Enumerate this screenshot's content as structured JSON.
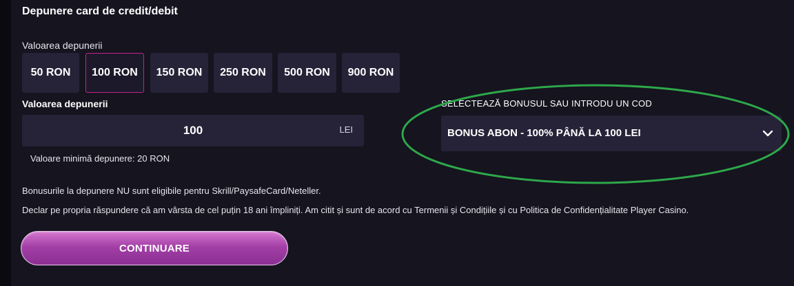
{
  "section": {
    "title": "Depunere card de credit/debit"
  },
  "amounts": {
    "label": "Valoarea depunerii",
    "options": [
      "50 RON",
      "100 RON",
      "150 RON",
      "250 RON",
      "500 RON",
      "900 RON"
    ],
    "selected": "100 RON"
  },
  "deposit": {
    "label": "Valoarea depunerii",
    "value": "100",
    "unit": "LEI",
    "min_note": "Valoare minimă depunere: 20 RON"
  },
  "bonus": {
    "label": "SELECTEAZĂ BONUSUL SAU INTRODU UN COD",
    "selected": "BONUS ABON - 100% PÂNĂ LA 100 LEI",
    "icon": "chevron-down-icon",
    "highlight_color": "#2ea84a"
  },
  "notices": {
    "eligibility": "Bonusurile la depunere NU sunt eligibile pentru Skrill/PaysafeCard/Neteller.",
    "declaration": "Declar pe propria răspundere că am vârsta de cel puțin 18 ani împliniți. Am citit și sunt de acord cu Termenii și Condițiile și cu Politica de Confidențialitate Player Casino."
  },
  "actions": {
    "continue_label": "CONTINUARE"
  },
  "colors": {
    "accent": "#c2248f",
    "button": "#a33fa6",
    "panel": "#15141f",
    "field": "#262338"
  }
}
